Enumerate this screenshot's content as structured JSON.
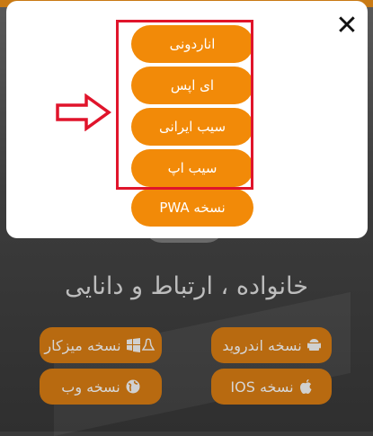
{
  "background": {
    "tagline": "خانواده ، ارتباط و دانایی",
    "downloads": [
      {
        "label": "نسخه اندروید",
        "icon": "android-icon"
      },
      {
        "label": "نسخه میزکار",
        "icon": "windows-linux-icon"
      },
      {
        "label": "نسخه IOS",
        "icon": "apple-icon"
      },
      {
        "label": "نسخه وب",
        "icon": "globe-icon"
      }
    ]
  },
  "modal": {
    "close_label": "✕",
    "options": [
      {
        "label": "اناردونی"
      },
      {
        "label": "ای اپس"
      },
      {
        "label": "سیب ایرانی"
      },
      {
        "label": "سیب اپ"
      },
      {
        "label": "نسخه PWA"
      }
    ],
    "highlight_color": "#e0142b",
    "accent_color": "#f28a08"
  }
}
